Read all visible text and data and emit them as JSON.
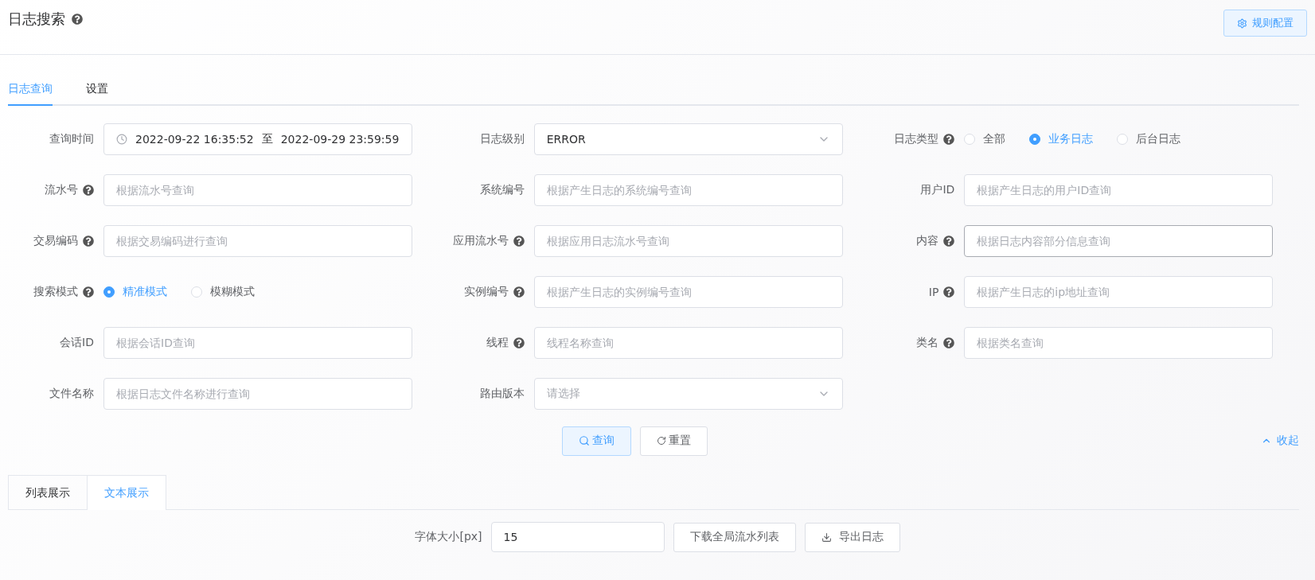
{
  "header": {
    "title": "日志搜索",
    "help": true,
    "rules_button": "规则配置"
  },
  "tabs": [
    {
      "label": "日志查询",
      "selected": true
    },
    {
      "label": "设置",
      "selected": false
    }
  ],
  "form": {
    "rows": [
      [
        {
          "kind": "daterange",
          "label": "查询时间",
          "help": false,
          "start": "2022-09-22 16:35:52",
          "separator": "至",
          "end": "2022-09-29 23:59:59"
        },
        {
          "kind": "select",
          "label": "日志级别",
          "help": false,
          "value": "ERROR"
        },
        {
          "kind": "radio",
          "label": "日志类型",
          "help": true,
          "options": [
            {
              "label": "全部",
              "selected": false
            },
            {
              "label": "业务日志",
              "selected": true
            },
            {
              "label": "后台日志",
              "selected": false
            }
          ]
        }
      ],
      [
        {
          "kind": "input",
          "label": "流水号",
          "help": true,
          "placeholder": "根据流水号查询",
          "focused": false
        },
        {
          "kind": "input",
          "label": "系统编号",
          "help": false,
          "placeholder": "根据产生日志的系统编号查询",
          "focused": false
        },
        {
          "kind": "input",
          "label": "用户ID",
          "help": false,
          "placeholder": "根据产生日志的用户ID查询",
          "focused": false
        }
      ],
      [
        {
          "kind": "input",
          "label": "交易编码",
          "help": true,
          "placeholder": "根据交易编码进行查询",
          "focused": false
        },
        {
          "kind": "input",
          "label": "应用流水号",
          "help": true,
          "placeholder": "根据应用日志流水号查询",
          "focused": false
        },
        {
          "kind": "input",
          "label": "内容",
          "help": true,
          "placeholder": "根据日志内容部分信息查询",
          "focused": true
        }
      ],
      [
        {
          "kind": "radio",
          "label": "搜索模式",
          "help": true,
          "options": [
            {
              "label": "精准模式",
              "selected": true
            },
            {
              "label": "模糊模式",
              "selected": false
            }
          ]
        },
        {
          "kind": "input",
          "label": "实例编号",
          "help": true,
          "placeholder": "根据产生日志的实例编号查询",
          "focused": false
        },
        {
          "kind": "input",
          "label": "IP",
          "help": true,
          "placeholder": "根据产生日志的ip地址查询",
          "focused": false
        }
      ],
      [
        {
          "kind": "input",
          "label": "会话ID",
          "help": false,
          "placeholder": "根据会话ID查询",
          "focused": false
        },
        {
          "kind": "input",
          "label": "线程",
          "help": true,
          "placeholder": "线程名称查询",
          "focused": false
        },
        {
          "kind": "input",
          "label": "类名",
          "help": true,
          "placeholder": "根据类名查询",
          "focused": false
        }
      ],
      [
        {
          "kind": "input",
          "label": "文件名称",
          "help": false,
          "placeholder": "根据日志文件名称进行查询",
          "focused": false
        },
        {
          "kind": "select",
          "label": "路由版本",
          "help": false,
          "placeholder": "请选择"
        }
      ]
    ],
    "search_button": "查询",
    "reset_button": "重置",
    "collapse_link": "收起"
  },
  "view_tabs": [
    {
      "label": "列表展示",
      "selected": false
    },
    {
      "label": "文本展示",
      "selected": true
    }
  ],
  "toolbar": {
    "font_size_label": "字体大小[px]",
    "font_size_value": "15",
    "download_button": "下载全局流水列表",
    "export_button": "导出日志"
  }
}
